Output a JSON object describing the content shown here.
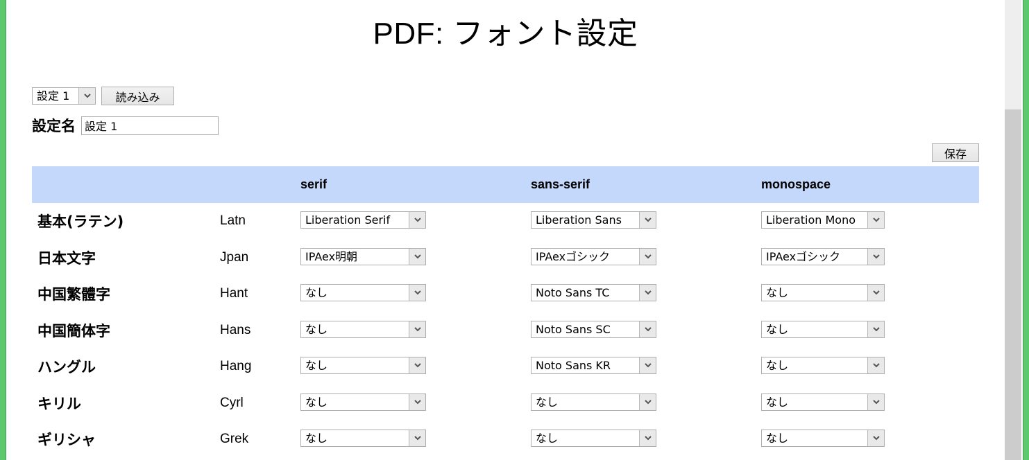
{
  "page": {
    "title": "PDF: フォント設定"
  },
  "preset": {
    "selected": "設定 1",
    "load_label": "読み込み",
    "name_label": "設定名",
    "name_value": "設定 1",
    "save_label": "保存"
  },
  "table": {
    "columns": [
      "",
      "",
      "serif",
      "sans-serif",
      "monospace"
    ],
    "rows": [
      {
        "lang": "基本(ラテン)",
        "code": "Latn",
        "serif": "Liberation Serif",
        "sans": "Liberation Sans",
        "mono": "Liberation Mono"
      },
      {
        "lang": "日本文字",
        "code": "Jpan",
        "serif": "IPAex明朝",
        "sans": "IPAexゴシック",
        "mono": "IPAexゴシック"
      },
      {
        "lang": "中国繁體字",
        "code": "Hant",
        "serif": "なし",
        "sans": "Noto Sans TC",
        "mono": "なし"
      },
      {
        "lang": "中国簡体字",
        "code": "Hans",
        "serif": "なし",
        "sans": "Noto Sans SC",
        "mono": "なし"
      },
      {
        "lang": "ハングル",
        "code": "Hang",
        "serif": "なし",
        "sans": "Noto Sans KR",
        "mono": "なし"
      },
      {
        "lang": "キリル",
        "code": "Cyrl",
        "serif": "なし",
        "sans": "なし",
        "mono": "なし"
      },
      {
        "lang": "ギリシャ",
        "code": "Grek",
        "serif": "なし",
        "sans": "なし",
        "mono": "なし"
      }
    ]
  },
  "colors": {
    "header_bg": "#c4d8fb",
    "frame": "#5ec86e",
    "scroll_track": "#eeeeee",
    "scroll_thumb": "#cccccc"
  },
  "icons": {
    "dropdown": "chevron-down-icon"
  }
}
